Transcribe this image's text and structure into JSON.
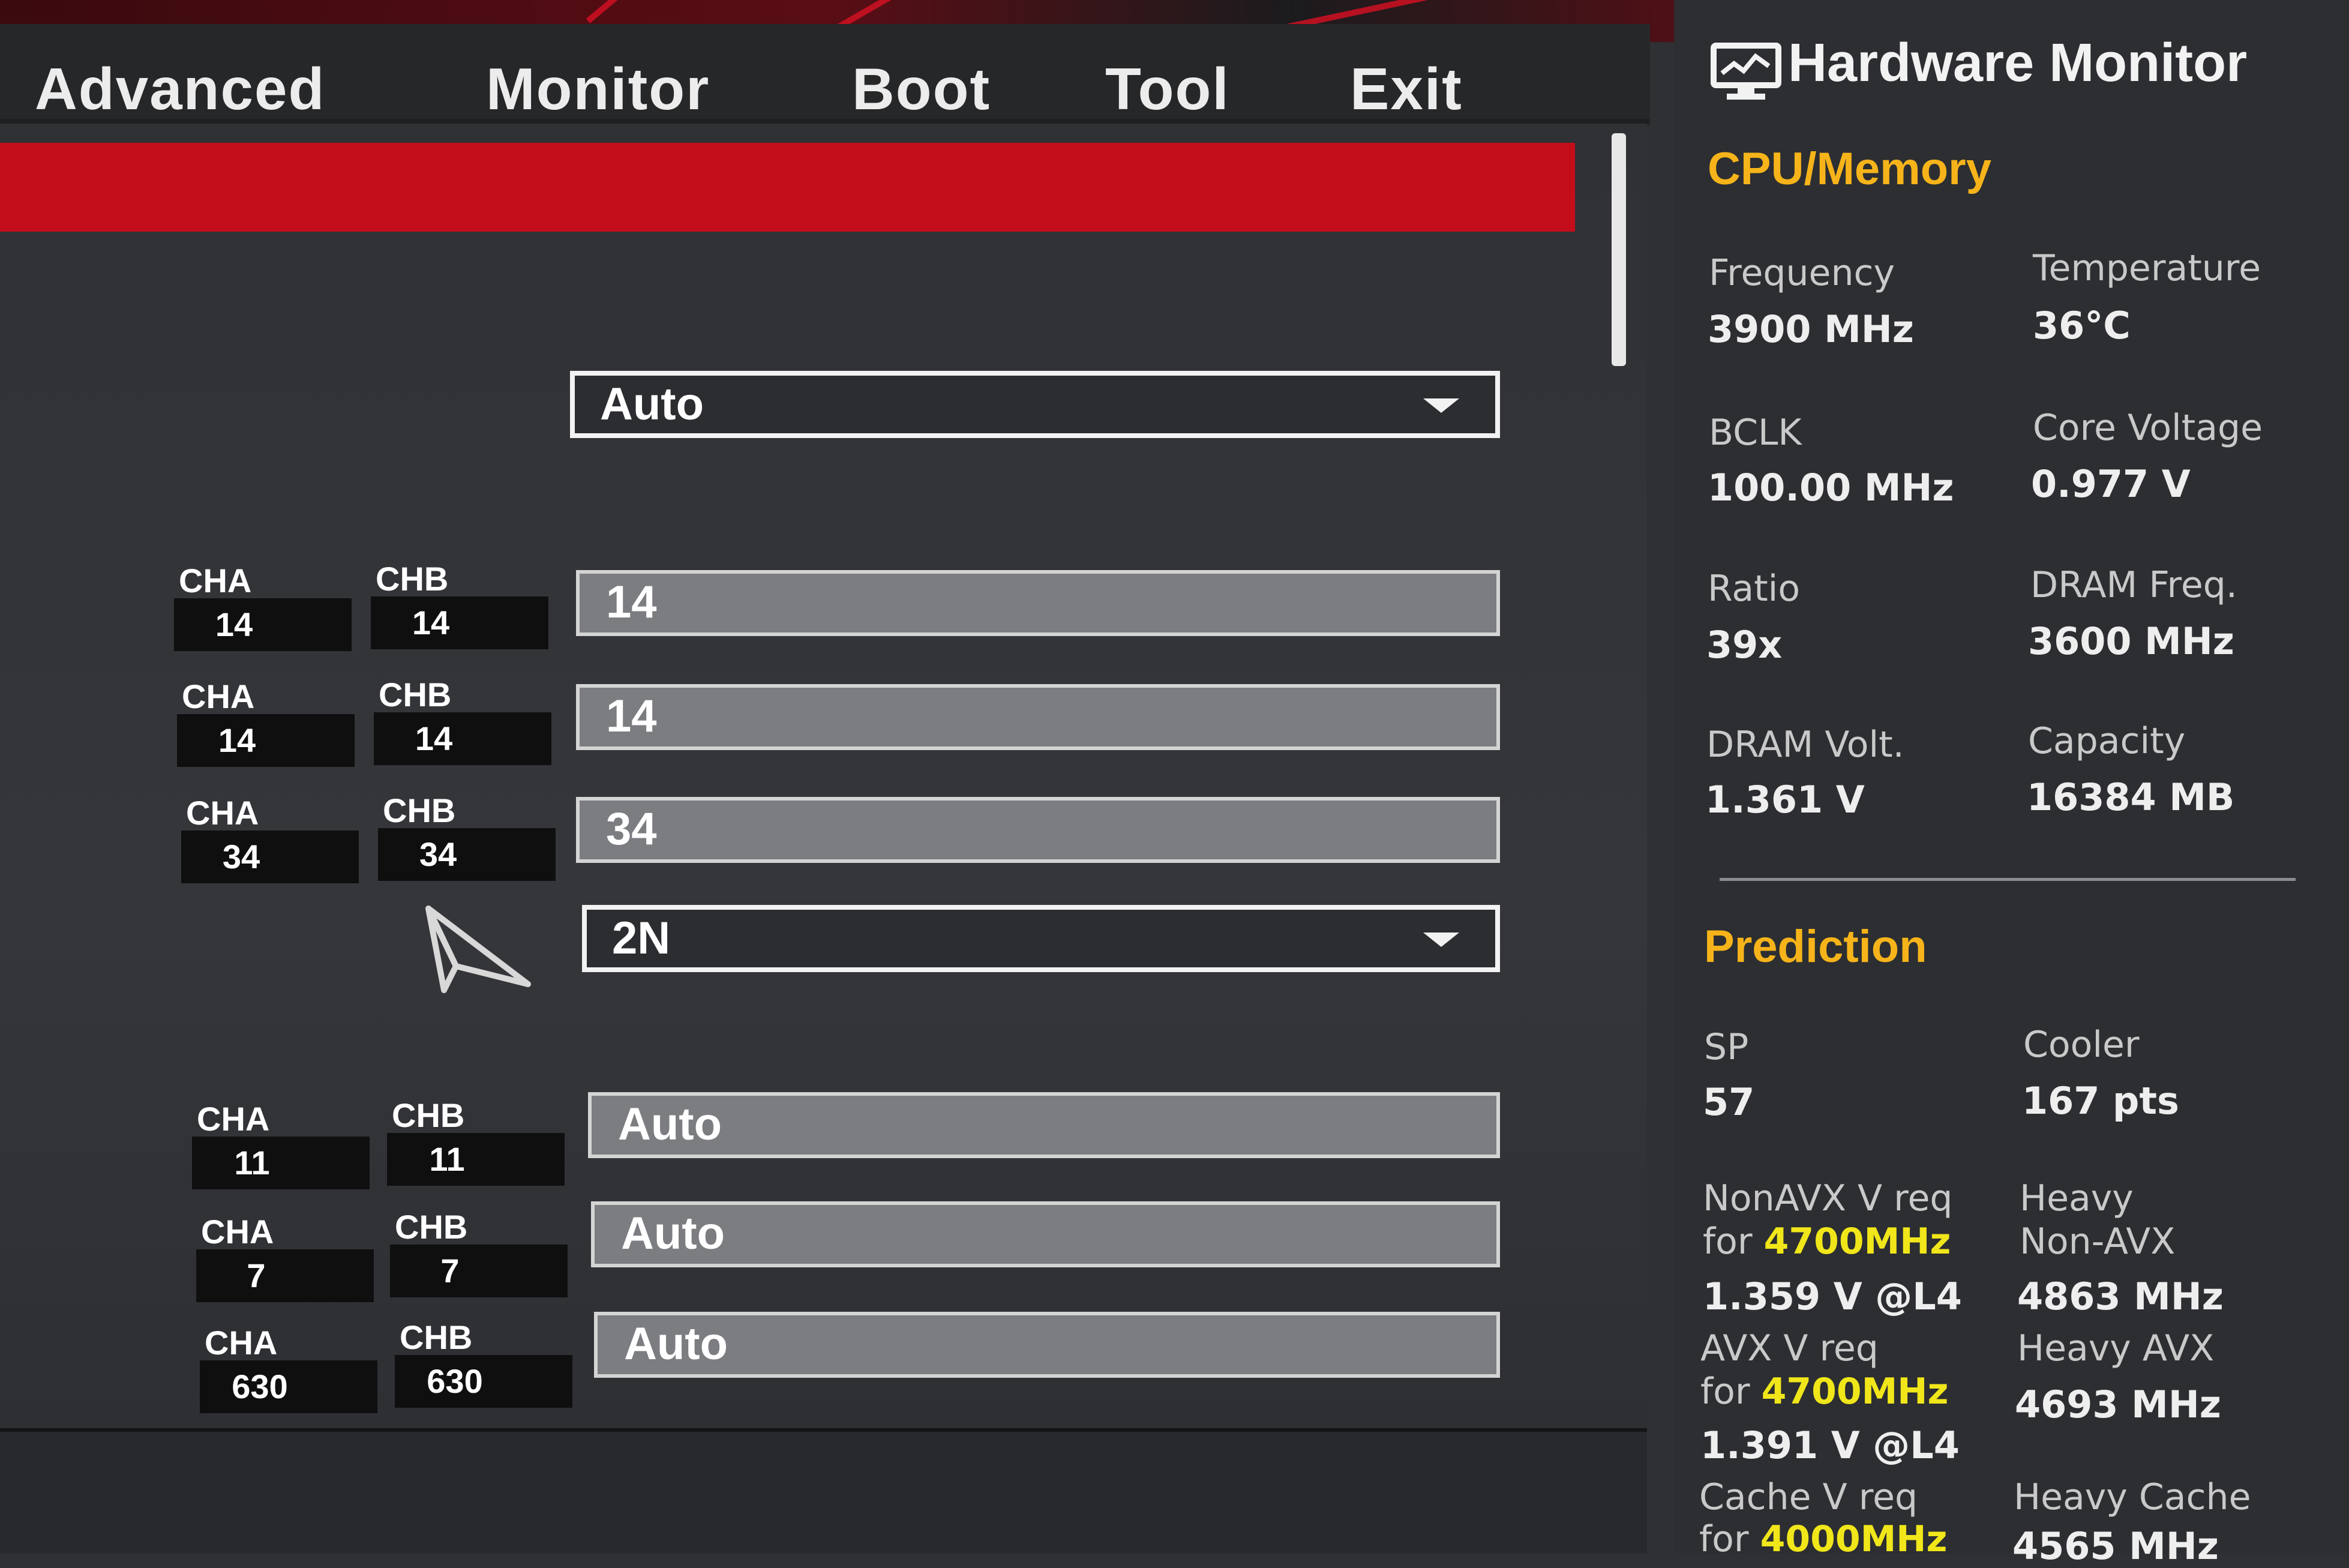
{
  "menu": {
    "tabs": [
      {
        "label": "Advanced"
      },
      {
        "label": "Monitor"
      },
      {
        "label": "Boot"
      },
      {
        "label": "Tool"
      },
      {
        "label": "Exit"
      }
    ]
  },
  "settings": {
    "mode_dropdown": {
      "value": "Auto"
    },
    "rows": [
      {
        "cha_label": "CHA",
        "cha_value": "14",
        "chb_label": "CHB",
        "chb_value": "14",
        "value": "14"
      },
      {
        "cha_label": "CHA",
        "cha_value": "14",
        "chb_label": "CHB",
        "chb_value": "14",
        "value": "14"
      },
      {
        "cha_label": "CHA",
        "cha_value": "34",
        "chb_label": "CHB",
        "chb_value": "34",
        "value": "34"
      },
      {
        "value": "2N"
      },
      {
        "cha_label": "CHA",
        "cha_value": "11",
        "chb_label": "CHB",
        "chb_value": "11",
        "value": "Auto"
      },
      {
        "cha_label": "CHA",
        "cha_value": "7",
        "chb_label": "CHB",
        "chb_value": "7",
        "value": "Auto"
      },
      {
        "cha_label": "CHA",
        "cha_value": "630",
        "chb_label": "CHB",
        "chb_value": "630",
        "value": "Auto"
      }
    ]
  },
  "hardware_monitor": {
    "title": "Hardware Monitor",
    "cpu_memory": {
      "title": "CPU/Memory",
      "frequency": {
        "label": "Frequency",
        "value": "3900 MHz"
      },
      "temperature": {
        "label": "Temperature",
        "value": "36°C"
      },
      "bclk": {
        "label": "BCLK",
        "value": "100.00 MHz"
      },
      "core_voltage": {
        "label": "Core Voltage",
        "value": "0.977 V"
      },
      "ratio": {
        "label": "Ratio",
        "value": "39x"
      },
      "dram_freq": {
        "label": "DRAM Freq.",
        "value": "3600 MHz"
      },
      "dram_volt": {
        "label": "DRAM Volt.",
        "value": "1.361 V"
      },
      "capacity": {
        "label": "Capacity",
        "value": "16384 MB"
      }
    },
    "prediction": {
      "title": "Prediction",
      "sp": {
        "label": "SP",
        "value": "57"
      },
      "cooler": {
        "label": "Cooler",
        "value": "167 pts"
      },
      "nonavx": {
        "label_line1": "NonAVX V req",
        "label_for": "for ",
        "label_freq": "4700MHz",
        "value": "1.359 V @L4"
      },
      "heavy_nonavx": {
        "label_line1": "Heavy",
        "label_line2": "Non-AVX",
        "value": "4863 MHz"
      },
      "avx": {
        "label_line1": "AVX V req",
        "label_for": "for ",
        "label_freq": "4700MHz",
        "value": "1.391 V @L4"
      },
      "heavy_avx": {
        "label": "Heavy AVX",
        "value": "4693 MHz"
      },
      "cache": {
        "label_line1": "Cache V req",
        "label_for": "for ",
        "label_freq": "4000MHz"
      },
      "heavy_cache": {
        "label": "Heavy Cache",
        "value": "4565 MHz"
      }
    }
  },
  "colors": {
    "accent_red": "#c40d1b",
    "section_title": "#f6b41a",
    "frequency_highlight": "#f0e61a"
  }
}
